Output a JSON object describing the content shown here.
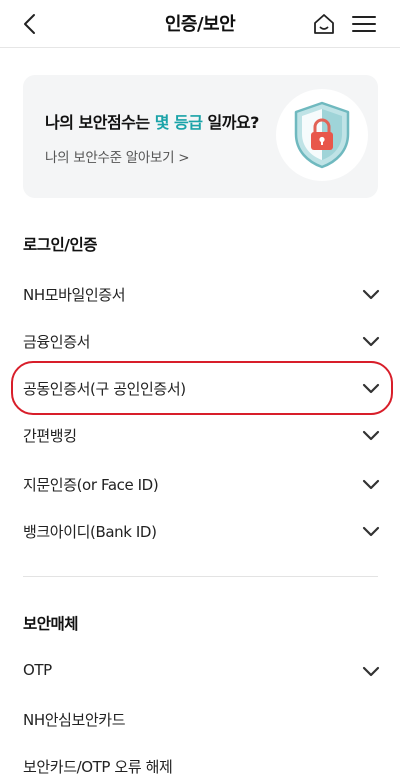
{
  "header": {
    "title": "인증/보안",
    "back_icon": "chevron-left-icon",
    "home_icon": "home-icon",
    "menu_icon": "hamburger-menu-icon"
  },
  "score_card": {
    "title_before": "나의 보안점수는 ",
    "title_accent": "몇 등급",
    "title_after": " 일까요?",
    "link_text": "나의 보안수준 알아보기",
    "link_arrow": ">",
    "accent_color": "#1aa3a8",
    "icon": "shield-lock-icon"
  },
  "sections": [
    {
      "title": "로그인/인증",
      "items": [
        {
          "label": "NH모바일인증서",
          "expandable": true
        },
        {
          "label": "금융인증서",
          "expandable": true
        },
        {
          "label": "공동인증서(구 공인인증서)",
          "expandable": true,
          "highlighted": true
        },
        {
          "label": "간편뱅킹",
          "expandable": true
        },
        {
          "label": "지문인증(or Face ID)",
          "expandable": true
        },
        {
          "label": "뱅크아이디(Bank ID)",
          "expandable": true
        }
      ]
    },
    {
      "title": "보안매체",
      "items": [
        {
          "label": "OTP",
          "expandable": true
        },
        {
          "label": "NH안심보안카드",
          "expandable": false
        },
        {
          "label": "보안카드/OTP 오류 해제",
          "expandable": false
        }
      ]
    }
  ],
  "highlight_color": "#d81e2a"
}
